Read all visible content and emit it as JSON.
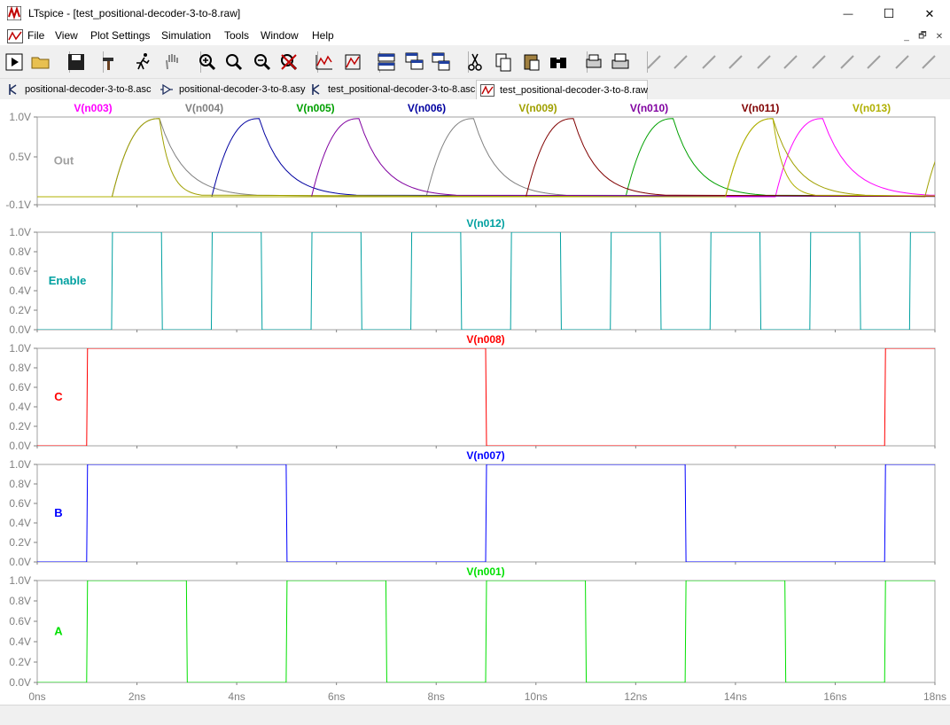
{
  "window": {
    "title": "LTspice - [test_positional-decoder-3-to-8.raw]",
    "minimize_glyph": "—",
    "maximize_glyph": "☐",
    "close_glyph": "✕"
  },
  "menu": {
    "items": [
      "File",
      "View",
      "Plot Settings",
      "Simulation",
      "Tools",
      "Window",
      "Help"
    ]
  },
  "mdi": {
    "minimize_glyph": "_",
    "restore_glyph": "🗗",
    "close_glyph": "✕"
  },
  "toolbar": {
    "icons": [
      "run-icon",
      "open-folder-icon",
      "save-icon",
      "hammer-icon",
      "running-man-icon",
      "hand-icon",
      "zoom-in-icon",
      "zoom-fit-icon",
      "zoom-out-icon",
      "zoom-cancel-icon",
      "autorange-icon",
      "plot-settings-icon",
      "tile-horizontal-icon",
      "cascade-icon",
      "tile-vertical-icon",
      "cut-icon",
      "copy-icon",
      "paste-icon",
      "find-icon",
      "print-preview-icon",
      "print-icon",
      "draw-wire-icon",
      "ground-icon",
      "label-icon",
      "resistor-icon",
      "capacitor-icon",
      "inductor-icon",
      "diode-icon",
      "component-icon",
      "move-icon",
      "drag-icon",
      "undo-icon"
    ]
  },
  "tabs": [
    {
      "label": "positional-decoder-3-to-8.asc",
      "icon": "schematic-icon",
      "active": false
    },
    {
      "label": "positional-decoder-3-to-8.asy",
      "icon": "symbol-icon",
      "active": false
    },
    {
      "label": "test_positional-decoder-3-to-8.asc",
      "icon": "schematic-icon",
      "active": false
    },
    {
      "label": "test_positional-decoder-3-to-8.raw",
      "icon": "waveform-icon",
      "active": true
    }
  ],
  "chart_data": {
    "type": "line",
    "x_unit": "ns",
    "xlim": [
      0,
      18
    ],
    "xticks": [
      "0ns",
      "2ns",
      "4ns",
      "6ns",
      "8ns",
      "10ns",
      "12ns",
      "14ns",
      "16ns",
      "18ns"
    ],
    "panes": [
      {
        "label": "Out",
        "label_color": "#a0a0a0",
        "ylim": [
          -0.1,
          1.0
        ],
        "yticks": [
          {
            "v": 1.0,
            "t": "1.0V"
          },
          {
            "v": 0.5,
            "t": "0.5V"
          },
          {
            "v": -0.1,
            "t": "-0.1V"
          }
        ],
        "series": [
          {
            "name": "V(n003)",
            "color": "#ff00ff",
            "segments": [
              [
                14.8,
                15.75,
                17.9
              ]
            ]
          },
          {
            "name": "V(n004)",
            "color": "#808080",
            "segments": [
              [
                1.5,
                2.45,
                4.4
              ],
              [
                7.8,
                8.75,
                10.6
              ]
            ]
          },
          {
            "name": "V(n005)",
            "color": "#00a000",
            "segments": [
              [
                11.8,
                12.75,
                14.6
              ]
            ]
          },
          {
            "name": "V(n006)",
            "color": "#0000a0",
            "segments": [
              [
                3.5,
                4.45,
                6.4
              ]
            ]
          },
          {
            "name": "V(n009)",
            "color": "#a0a000",
            "segments": [
              [
                1.5,
                2.45,
                3.3
              ],
              [
                13.8,
                14.75,
                16.6
              ],
              [
                17.8,
                18.75,
                20.6
              ]
            ]
          },
          {
            "name": "V(n010)",
            "color": "#8000a0",
            "segments": [
              [
                5.5,
                6.45,
                8.4
              ]
            ]
          },
          {
            "name": "V(n011)",
            "color": "#800000",
            "segments": [
              [
                9.8,
                10.75,
                12.6
              ]
            ]
          },
          {
            "name": "V(n013)",
            "color": "#b0b000",
            "segments": [
              [
                13.8,
                14.75,
                15.6
              ]
            ]
          }
        ]
      },
      {
        "label": "Enable",
        "label_color": "#00a0a0",
        "ylim": [
          0,
          1.0
        ],
        "yticks": [
          {
            "v": 1.0,
            "t": "1.0V"
          },
          {
            "v": 0.8,
            "t": "0.8V"
          },
          {
            "v": 0.6,
            "t": "0.6V"
          },
          {
            "v": 0.4,
            "t": "0.4V"
          },
          {
            "v": 0.2,
            "t": "0.2V"
          },
          {
            "v": 0.0,
            "t": "0.0V"
          }
        ],
        "series": [
          {
            "name": "V(n012)",
            "color": "#00a0a0",
            "digital": true,
            "transitions": [
              [
                0,
                0
              ],
              [
                1.5,
                1
              ],
              [
                2.5,
                0
              ],
              [
                3.5,
                1
              ],
              [
                4.5,
                0
              ],
              [
                5.5,
                1
              ],
              [
                6.5,
                0
              ],
              [
                7.5,
                1
              ],
              [
                8.5,
                0
              ],
              [
                9.5,
                1
              ],
              [
                10.5,
                0
              ],
              [
                11.5,
                1
              ],
              [
                12.5,
                0
              ],
              [
                13.5,
                1
              ],
              [
                14.5,
                0
              ],
              [
                15.5,
                1
              ],
              [
                16.5,
                0
              ],
              [
                17.5,
                1
              ]
            ]
          }
        ]
      },
      {
        "label": "C",
        "label_color": "#ff0000",
        "ylim": [
          0,
          1.0
        ],
        "yticks": [
          {
            "v": 1.0,
            "t": "1.0V"
          },
          {
            "v": 0.8,
            "t": "0.8V"
          },
          {
            "v": 0.6,
            "t": "0.6V"
          },
          {
            "v": 0.4,
            "t": "0.4V"
          },
          {
            "v": 0.2,
            "t": "0.2V"
          },
          {
            "v": 0.0,
            "t": "0.0V"
          }
        ],
        "series": [
          {
            "name": "V(n008)",
            "color": "#ff0000",
            "digital": true,
            "transitions": [
              [
                0,
                0
              ],
              [
                1.0,
                1
              ],
              [
                9.0,
                0
              ],
              [
                17.0,
                1
              ]
            ]
          }
        ]
      },
      {
        "label": "B",
        "label_color": "#0000ff",
        "ylim": [
          0,
          1.0
        ],
        "yticks": [
          {
            "v": 1.0,
            "t": "1.0V"
          },
          {
            "v": 0.8,
            "t": "0.8V"
          },
          {
            "v": 0.6,
            "t": "0.6V"
          },
          {
            "v": 0.4,
            "t": "0.4V"
          },
          {
            "v": 0.2,
            "t": "0.2V"
          },
          {
            "v": 0.0,
            "t": "0.0V"
          }
        ],
        "series": [
          {
            "name": "V(n007)",
            "color": "#0000ff",
            "digital": true,
            "transitions": [
              [
                0,
                0
              ],
              [
                1.0,
                1
              ],
              [
                5.0,
                0
              ],
              [
                9.0,
                1
              ],
              [
                13.0,
                0
              ],
              [
                17.0,
                1
              ]
            ]
          }
        ]
      },
      {
        "label": "A",
        "label_color": "#00e000",
        "ylim": [
          0,
          1.0
        ],
        "yticks": [
          {
            "v": 1.0,
            "t": "1.0V"
          },
          {
            "v": 0.8,
            "t": "0.8V"
          },
          {
            "v": 0.6,
            "t": "0.6V"
          },
          {
            "v": 0.4,
            "t": "0.4V"
          },
          {
            "v": 0.2,
            "t": "0.2V"
          },
          {
            "v": 0.0,
            "t": "0.0V"
          }
        ],
        "series": [
          {
            "name": "V(n001)",
            "color": "#00e000",
            "digital": true,
            "transitions": [
              [
                0,
                0
              ],
              [
                1.0,
                1
              ],
              [
                3.0,
                0
              ],
              [
                5.0,
                1
              ],
              [
                7.0,
                0
              ],
              [
                9.0,
                1
              ],
              [
                11.0,
                0
              ],
              [
                13.0,
                1
              ],
              [
                15.0,
                0
              ],
              [
                17.0,
                1
              ]
            ]
          }
        ]
      }
    ]
  }
}
